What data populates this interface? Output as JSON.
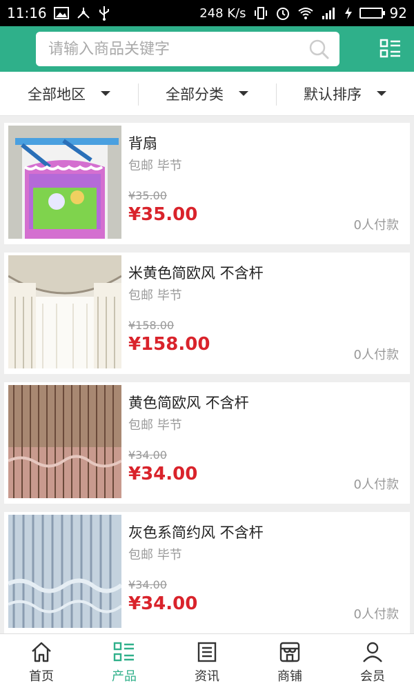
{
  "status_bar": {
    "time": "11:16",
    "speed": "248 K/s",
    "battery": "92"
  },
  "search": {
    "placeholder": "请输入商品关键字"
  },
  "filters": [
    {
      "label": "全部地区"
    },
    {
      "label": "全部分类"
    },
    {
      "label": "默认排序"
    }
  ],
  "products": [
    {
      "name": "背扇",
      "shipping": "包邮 毕节",
      "old_price": "¥35.00",
      "price": "¥35.00",
      "paid": "0人付款",
      "image": "baby-carrier-photo"
    },
    {
      "name": "米黄色简欧风 不含杆",
      "shipping": "包邮 毕节",
      "old_price": "¥158.00",
      "price": "¥158.00",
      "paid": "0人付款",
      "image": "beige-curtain-photo"
    },
    {
      "name": "黄色简欧风 不含杆",
      "shipping": "包邮 毕节",
      "old_price": "¥34.00",
      "price": "¥34.00",
      "paid": "0人付款",
      "image": "brown-curtain-photo"
    },
    {
      "name": "灰色系简约风 不含杆",
      "shipping": "包邮 毕节",
      "old_price": "¥34.00",
      "price": "¥34.00",
      "paid": "0人付款",
      "image": "grey-curtain-photo"
    }
  ],
  "nav": [
    {
      "label": "首页",
      "icon": "home-icon"
    },
    {
      "label": "产品",
      "icon": "list-icon",
      "active": true
    },
    {
      "label": "资讯",
      "icon": "news-icon"
    },
    {
      "label": "商铺",
      "icon": "shop-icon"
    },
    {
      "label": "会员",
      "icon": "user-icon"
    }
  ],
  "colors": {
    "accent": "#2fb08a",
    "price": "#d9232b"
  }
}
